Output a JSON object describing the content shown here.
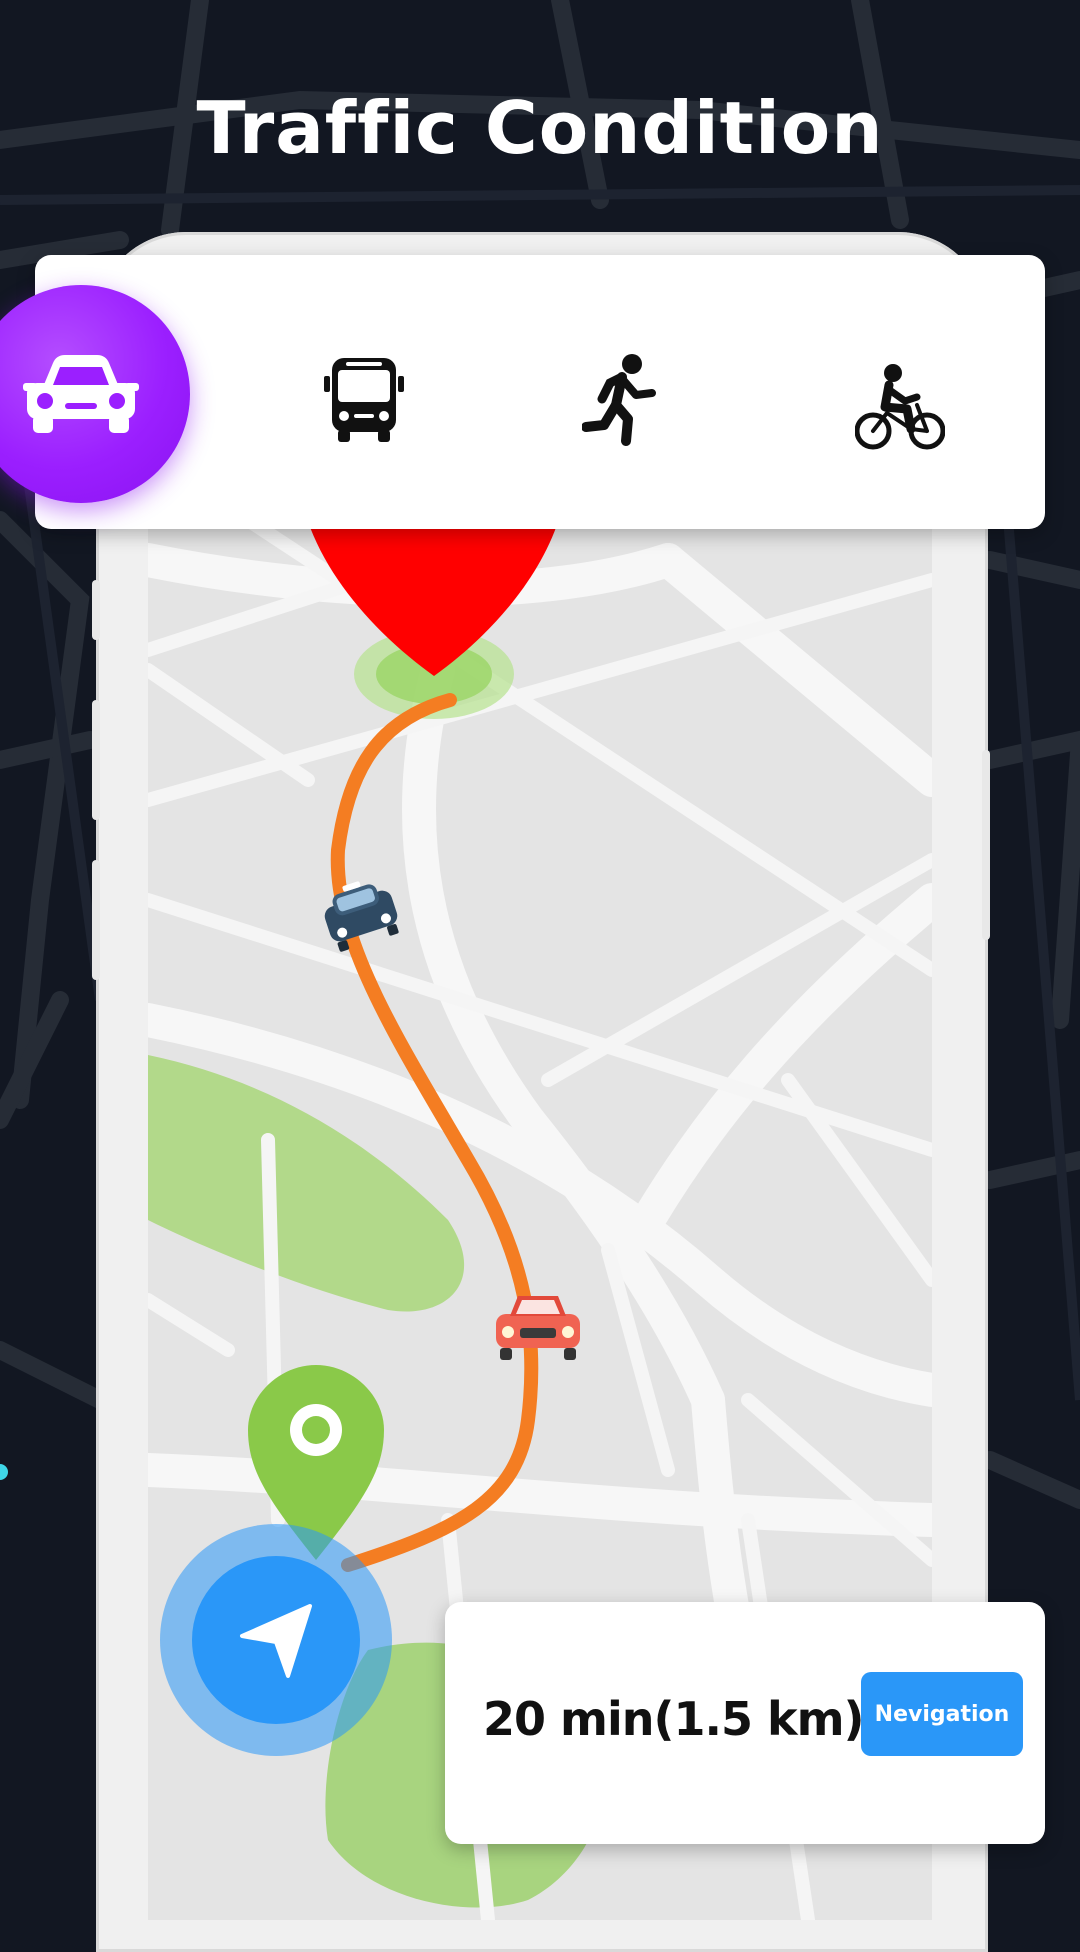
{
  "header": {
    "title": "Traffic Condition"
  },
  "transport_modes": [
    {
      "name": "car",
      "icon": "car-icon",
      "selected": true
    },
    {
      "name": "bus",
      "icon": "bus-icon",
      "selected": false
    },
    {
      "name": "walk",
      "icon": "walking-icon",
      "selected": false
    },
    {
      "name": "bike",
      "icon": "bicycle-icon",
      "selected": false
    }
  ],
  "route": {
    "duration_value": "20",
    "duration_unit": "min",
    "distance": "(1.5 km)",
    "navigation_label": "Nevigation"
  },
  "colors": {
    "accent_purple": "#9b1fff",
    "route_orange": "#f47d22",
    "destination_red": "#ff0000",
    "origin_green": "#8ac949",
    "nav_blue": "#2a97f8",
    "background_dark": "#121722"
  }
}
